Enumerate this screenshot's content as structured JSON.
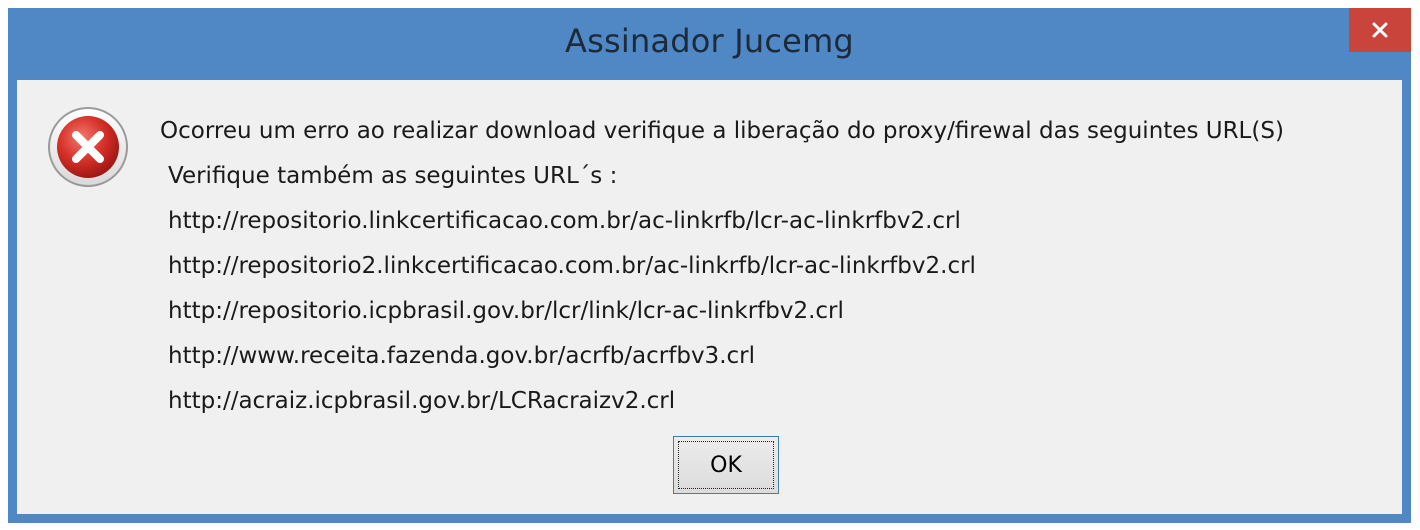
{
  "window": {
    "title": "Assinador Jucemg",
    "accent_color": "#4f88c4",
    "close_button_color": "#c9453c"
  },
  "dialog": {
    "icon": "error-icon",
    "lines": [
      "Ocorreu um erro ao realizar download verifique a liberação do proxy/firewal das seguintes URL(S)",
      "Verifique também as seguintes URL´s :",
      "http://repositorio.linkcertificacao.com.br/ac-linkrfb/lcr-ac-linkrfbv2.crl",
      "http://repositorio2.linkcertificacao.com.br/ac-linkrfb/lcr-ac-linkrfbv2.crl",
      "http://repositorio.icpbrasil.gov.br/lcr/link/lcr-ac-linkrfbv2.crl",
      "http://www.receita.fazenda.gov.br/acrfb/acrfbv3.crl",
      "http://acraiz.icpbrasil.gov.br/LCRacraizv2.crl"
    ],
    "ok_label": "OK"
  }
}
